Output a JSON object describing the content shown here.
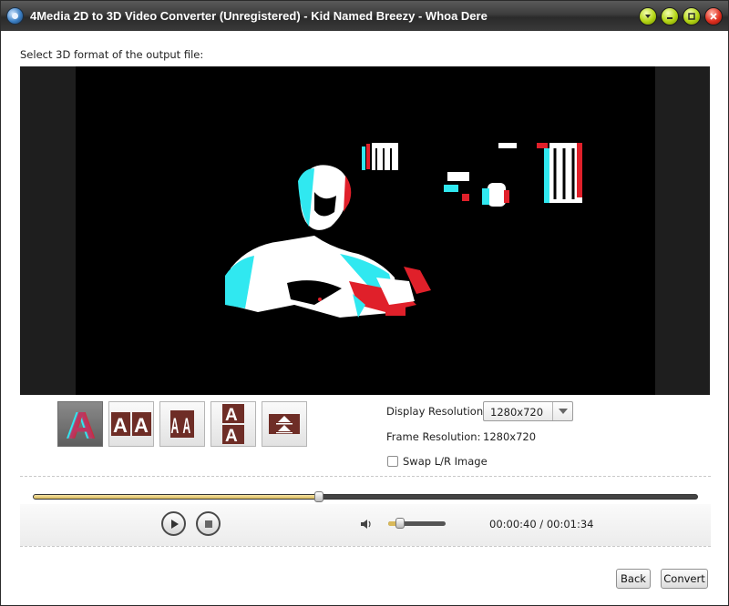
{
  "window": {
    "title": "4Media 2D to 3D Video Converter (Unregistered) - Kid Named Breezy - Whoa Dere",
    "app_icon": "film-reel-icon",
    "buttons": {
      "menu_icon": "chevron-down-icon",
      "minimize_icon": "minimize-icon",
      "maximize_icon": "maximize-icon",
      "close_icon": "close-icon"
    }
  },
  "main": {
    "prompt": "Select 3D format of the output file:",
    "formats": [
      {
        "name": "anaglyph",
        "icon": "anaglyph-a-icon",
        "selected": true
      },
      {
        "name": "side-by-side",
        "icon": "side-by-side-aa-icon",
        "selected": false
      },
      {
        "name": "side-by-side-half",
        "icon": "side-by-side-half-icon",
        "selected": false
      },
      {
        "name": "top-bottom",
        "icon": "top-bottom-icon",
        "selected": false
      },
      {
        "name": "top-bottom-half",
        "icon": "top-bottom-half-icon",
        "selected": false
      }
    ],
    "display_resolution_label": "Display Resolution:",
    "display_resolution_value": "1280x720",
    "frame_resolution_label": "Frame Resolution:",
    "frame_resolution_value": "1280x720",
    "swap_label": "Swap L/R Image",
    "swap_checked": false
  },
  "player": {
    "progress": 0.43,
    "volume": 0.2,
    "time_display": "00:00:40 / 00:01:34",
    "play_icon": "play-icon",
    "stop_icon": "stop-icon",
    "volume_icon": "speaker-icon"
  },
  "footer": {
    "back_label": "Back",
    "convert_label": "Convert"
  },
  "colors": {
    "accent": "#d9b95a",
    "anaglyph_red": "#e0202a",
    "anaglyph_cyan": "#30e8f0"
  }
}
